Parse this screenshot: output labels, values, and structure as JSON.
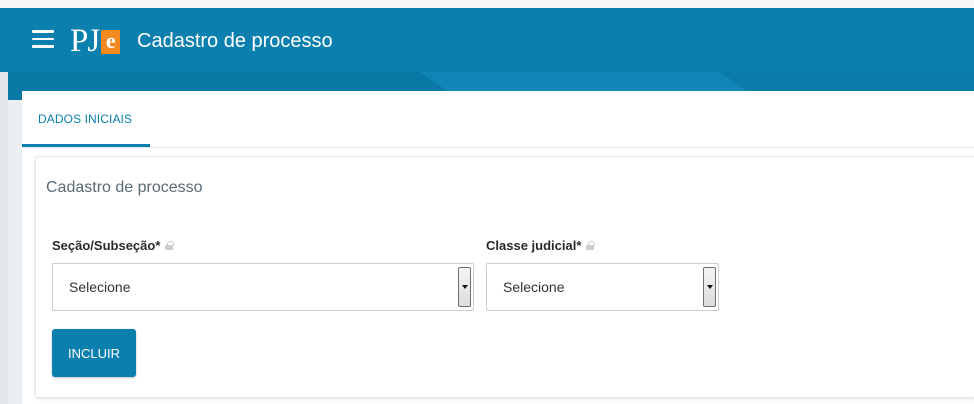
{
  "header": {
    "menu_icon": "hamburger-icon",
    "logo_letters": "PJ",
    "logo_accent": "e",
    "title": "Cadastro de processo",
    "colors": {
      "primary": "#0b7fae",
      "logo_accent": "#f28a20"
    }
  },
  "tabs": [
    {
      "label": "DADOS INICIAIS",
      "active": true
    }
  ],
  "form": {
    "title": "Cadastro de processo",
    "fields": [
      {
        "label": "Seção/Subseção*",
        "value": "Selecione",
        "icon": "lock-icon"
      },
      {
        "label": "Classe judicial*",
        "value": "Selecione",
        "icon": "lock-icon"
      }
    ],
    "submit_label": "INCLUIR"
  }
}
